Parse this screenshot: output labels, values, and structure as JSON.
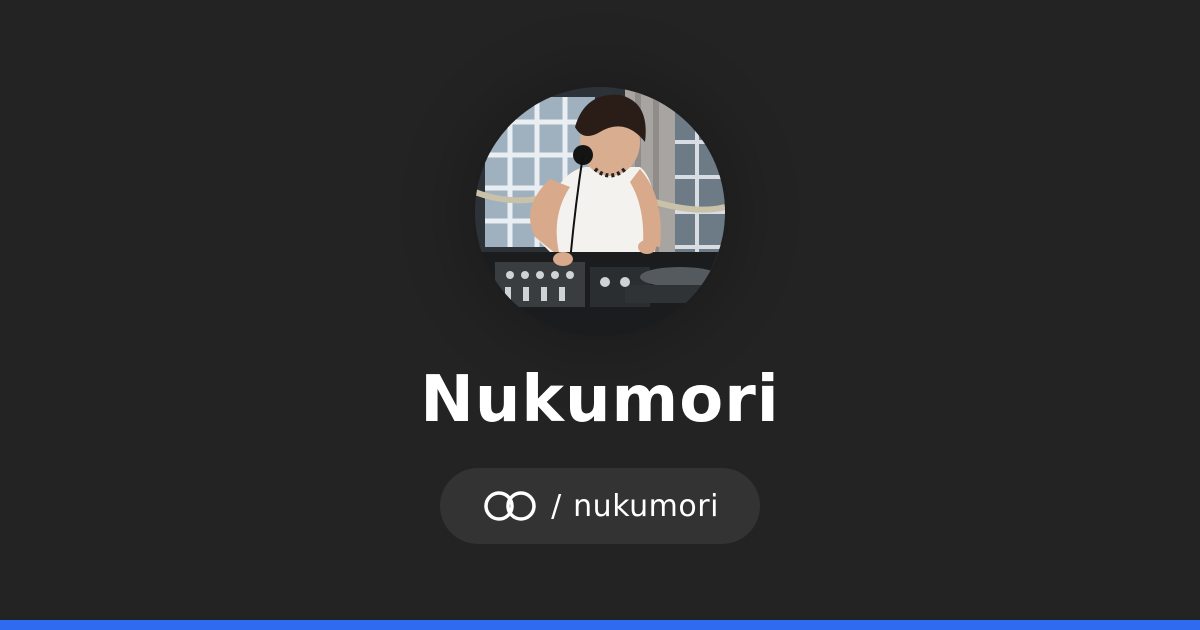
{
  "profile": {
    "display_name": "Nukumori",
    "separator": "/",
    "handle": "nukumori",
    "avatar_alt": "Nukumori avatar"
  },
  "icons": {
    "brand_logo": "linked-rings-icon"
  },
  "colors": {
    "background": "#232323",
    "pill_background": "#333333",
    "text": "#ffffff",
    "accent_bar": "#2F6BF1"
  }
}
